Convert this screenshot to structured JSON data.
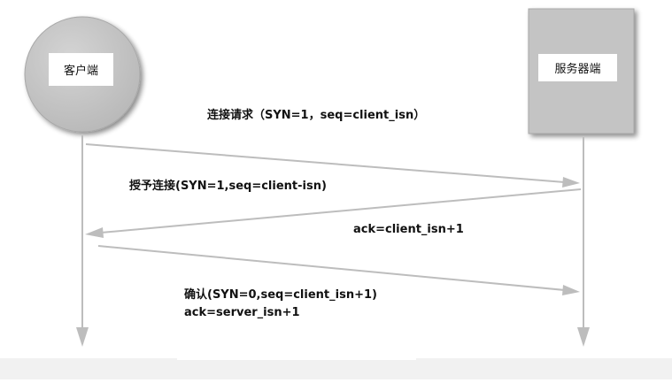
{
  "client": {
    "label": "客户端"
  },
  "server": {
    "label": "服务器端"
  },
  "messages": {
    "syn": "连接请求（SYN=1，seq=client_isn）",
    "synack_line1": "授予连接(SYN=1,seq=client-isn)",
    "synack_line2": "ack=client_isn+1",
    "ack_line1": "确认(SYN=0,seq=client_isn+1)",
    "ack_line2": "ack=server_isn+1"
  },
  "colors": {
    "line": "#bdbdbd",
    "client_circle": "#c4c4c4",
    "server_box": "#c4c4c4",
    "text": "#111111"
  }
}
